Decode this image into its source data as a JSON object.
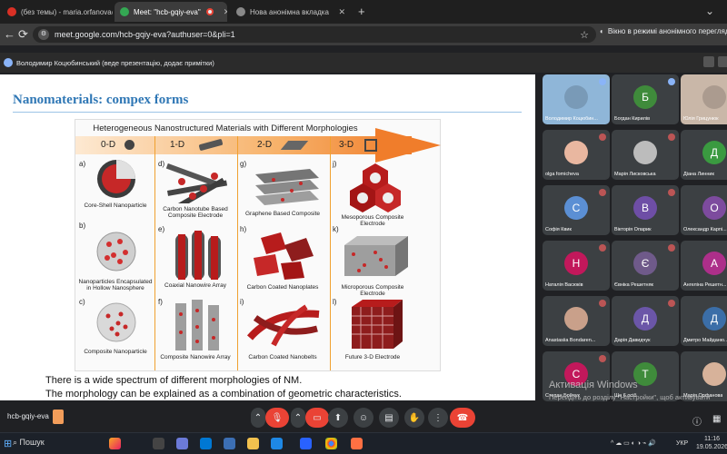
{
  "browser": {
    "tabs": [
      {
        "label": "(без темы) - maria.orfanova@...",
        "active": false,
        "fav_color": "#d93025"
      },
      {
        "label": "Meet: \"hcb-gqiy-eva\"",
        "active": true,
        "fav_color": "#34a853"
      },
      {
        "label": "Нова анонімна вкладка",
        "active": false,
        "fav_color": "#888888"
      }
    ],
    "new_tab_icon": "+",
    "url": "meet.google.com/hcb-gqiy-eva?authuser=0&pli=1",
    "incognito_label": "Вікно в режимі анонімного перегляду"
  },
  "info_bar": {
    "text": "Володимир Коцюбинський (веде презентацію, додає примітки)"
  },
  "slide": {
    "title": "Nanomaterials: compex forms",
    "figure": {
      "title": "Heterogeneous  Nanostructured Materials with Different Morphologies",
      "dimensions": [
        "0-D",
        "1-D",
        "2-D",
        "3-D"
      ],
      "items": [
        {
          "letter": "a)",
          "label": "Core-Shell Nanoparticle"
        },
        {
          "letter": "b)",
          "label": "Nanoparticles Encapsulated in Hollow Nanosphere"
        },
        {
          "letter": "c)",
          "label": "Composite Nanoparticle"
        },
        {
          "letter": "d)",
          "label": "Carbon Nanotube Based Composite Electrode"
        },
        {
          "letter": "e)",
          "label": "Coaxial Nanowire Array"
        },
        {
          "letter": "f)",
          "label": "Composite Nanowire Array"
        },
        {
          "letter": "g)",
          "label": "Graphene Based Composite"
        },
        {
          "letter": "h)",
          "label": "Carbon Coated Nanoplates"
        },
        {
          "letter": "i)",
          "label": "Carbon Coated Nanobelts"
        },
        {
          "letter": "j)",
          "label": "Mesoporous Composite Electrode"
        },
        {
          "letter": "k)",
          "label": "Microporous Composite Electrode"
        },
        {
          "letter": "l)",
          "label": "Future 3-D Electrode"
        }
      ]
    },
    "caption_line1": "There is a wide spectrum of different morphologies of NM.",
    "caption_line2": "The morphology can be explained as a combination of geometric characteristics."
  },
  "participants": [
    {
      "name": "Володимир Коцюбин...",
      "initial": "",
      "color": "#8fb6d8",
      "video": true,
      "mic": "on"
    },
    {
      "name": "Богдан Кирилів",
      "initial": "Б",
      "color": "#3f8b3b",
      "video": false,
      "mic": "on"
    },
    {
      "name": "Юлія Грицунюк",
      "initial": "",
      "color": "#c9b7a8",
      "video": true,
      "mic": "off"
    },
    {
      "name": "olga fomicheva",
      "initial": "",
      "color": "#e9b7a0",
      "video": false,
      "mic": "off"
    },
    {
      "name": "Марія Лисковська",
      "initial": "",
      "color": "#bcbcbc",
      "video": false,
      "mic": "off"
    },
    {
      "name": "Діана Линник",
      "initial": "Д",
      "color": "#3a9a40",
      "video": false,
      "mic": "off"
    },
    {
      "name": "Софія Квик",
      "initial": "С",
      "color": "#5b8fd4",
      "video": false,
      "mic": "off"
    },
    {
      "name": "Вікторія Опарик",
      "initial": "В",
      "color": "#6e4ea6",
      "video": false,
      "mic": "off"
    },
    {
      "name": "Олександр Карпі...",
      "initial": "О",
      "color": "#7d4b9e",
      "video": false,
      "mic": "off"
    },
    {
      "name": "Наталія Васюків",
      "initial": "Н",
      "color": "#c2185b",
      "video": false,
      "mic": "off"
    },
    {
      "name": "Євніка Решетняк",
      "initial": "Є",
      "color": "#6f5a8a",
      "video": false,
      "mic": "off"
    },
    {
      "name": "Ангеліна Решетн...",
      "initial": "А",
      "color": "#ad2f8a",
      "video": false,
      "mic": "off"
    },
    {
      "name": "Anastasiia Bondaren...",
      "initial": "",
      "color": "#c9a08a",
      "video": false,
      "mic": "off"
    },
    {
      "name": "Дарія Давидчук",
      "initial": "Д",
      "color": "#6b56a8",
      "video": false,
      "mic": "off"
    },
    {
      "name": "Дмитро Майданю...",
      "initial": "Д",
      "color": "#3b6ea8",
      "video": false,
      "mic": "off"
    },
    {
      "name": "Степан Бойчук",
      "initial": "С",
      "color": "#c2185b",
      "video": false,
      "mic": "off"
    },
    {
      "name": "Ще 6 осіб",
      "initial": "Т",
      "color": "#3f8b3b",
      "video": false,
      "mic": "none"
    },
    {
      "name": "Марія Орфанова",
      "initial": "",
      "color": "#d7b29a",
      "video": false,
      "mic": "off"
    }
  ],
  "watermark": {
    "line1": "Активація Windows",
    "line2": "Перейдіть до розділу \"Настройки\", щоб активувати Windows."
  },
  "controls": {
    "meeting_code": "hcb-gqiy-eva",
    "buttons": [
      "mic-off",
      "camera-off",
      "present",
      "emoji",
      "captions",
      "raise-hand",
      "more"
    ]
  },
  "taskbar": {
    "search_label": "Пошук",
    "language": "УКР",
    "time": "11:16",
    "date": "19.05.2026"
  }
}
